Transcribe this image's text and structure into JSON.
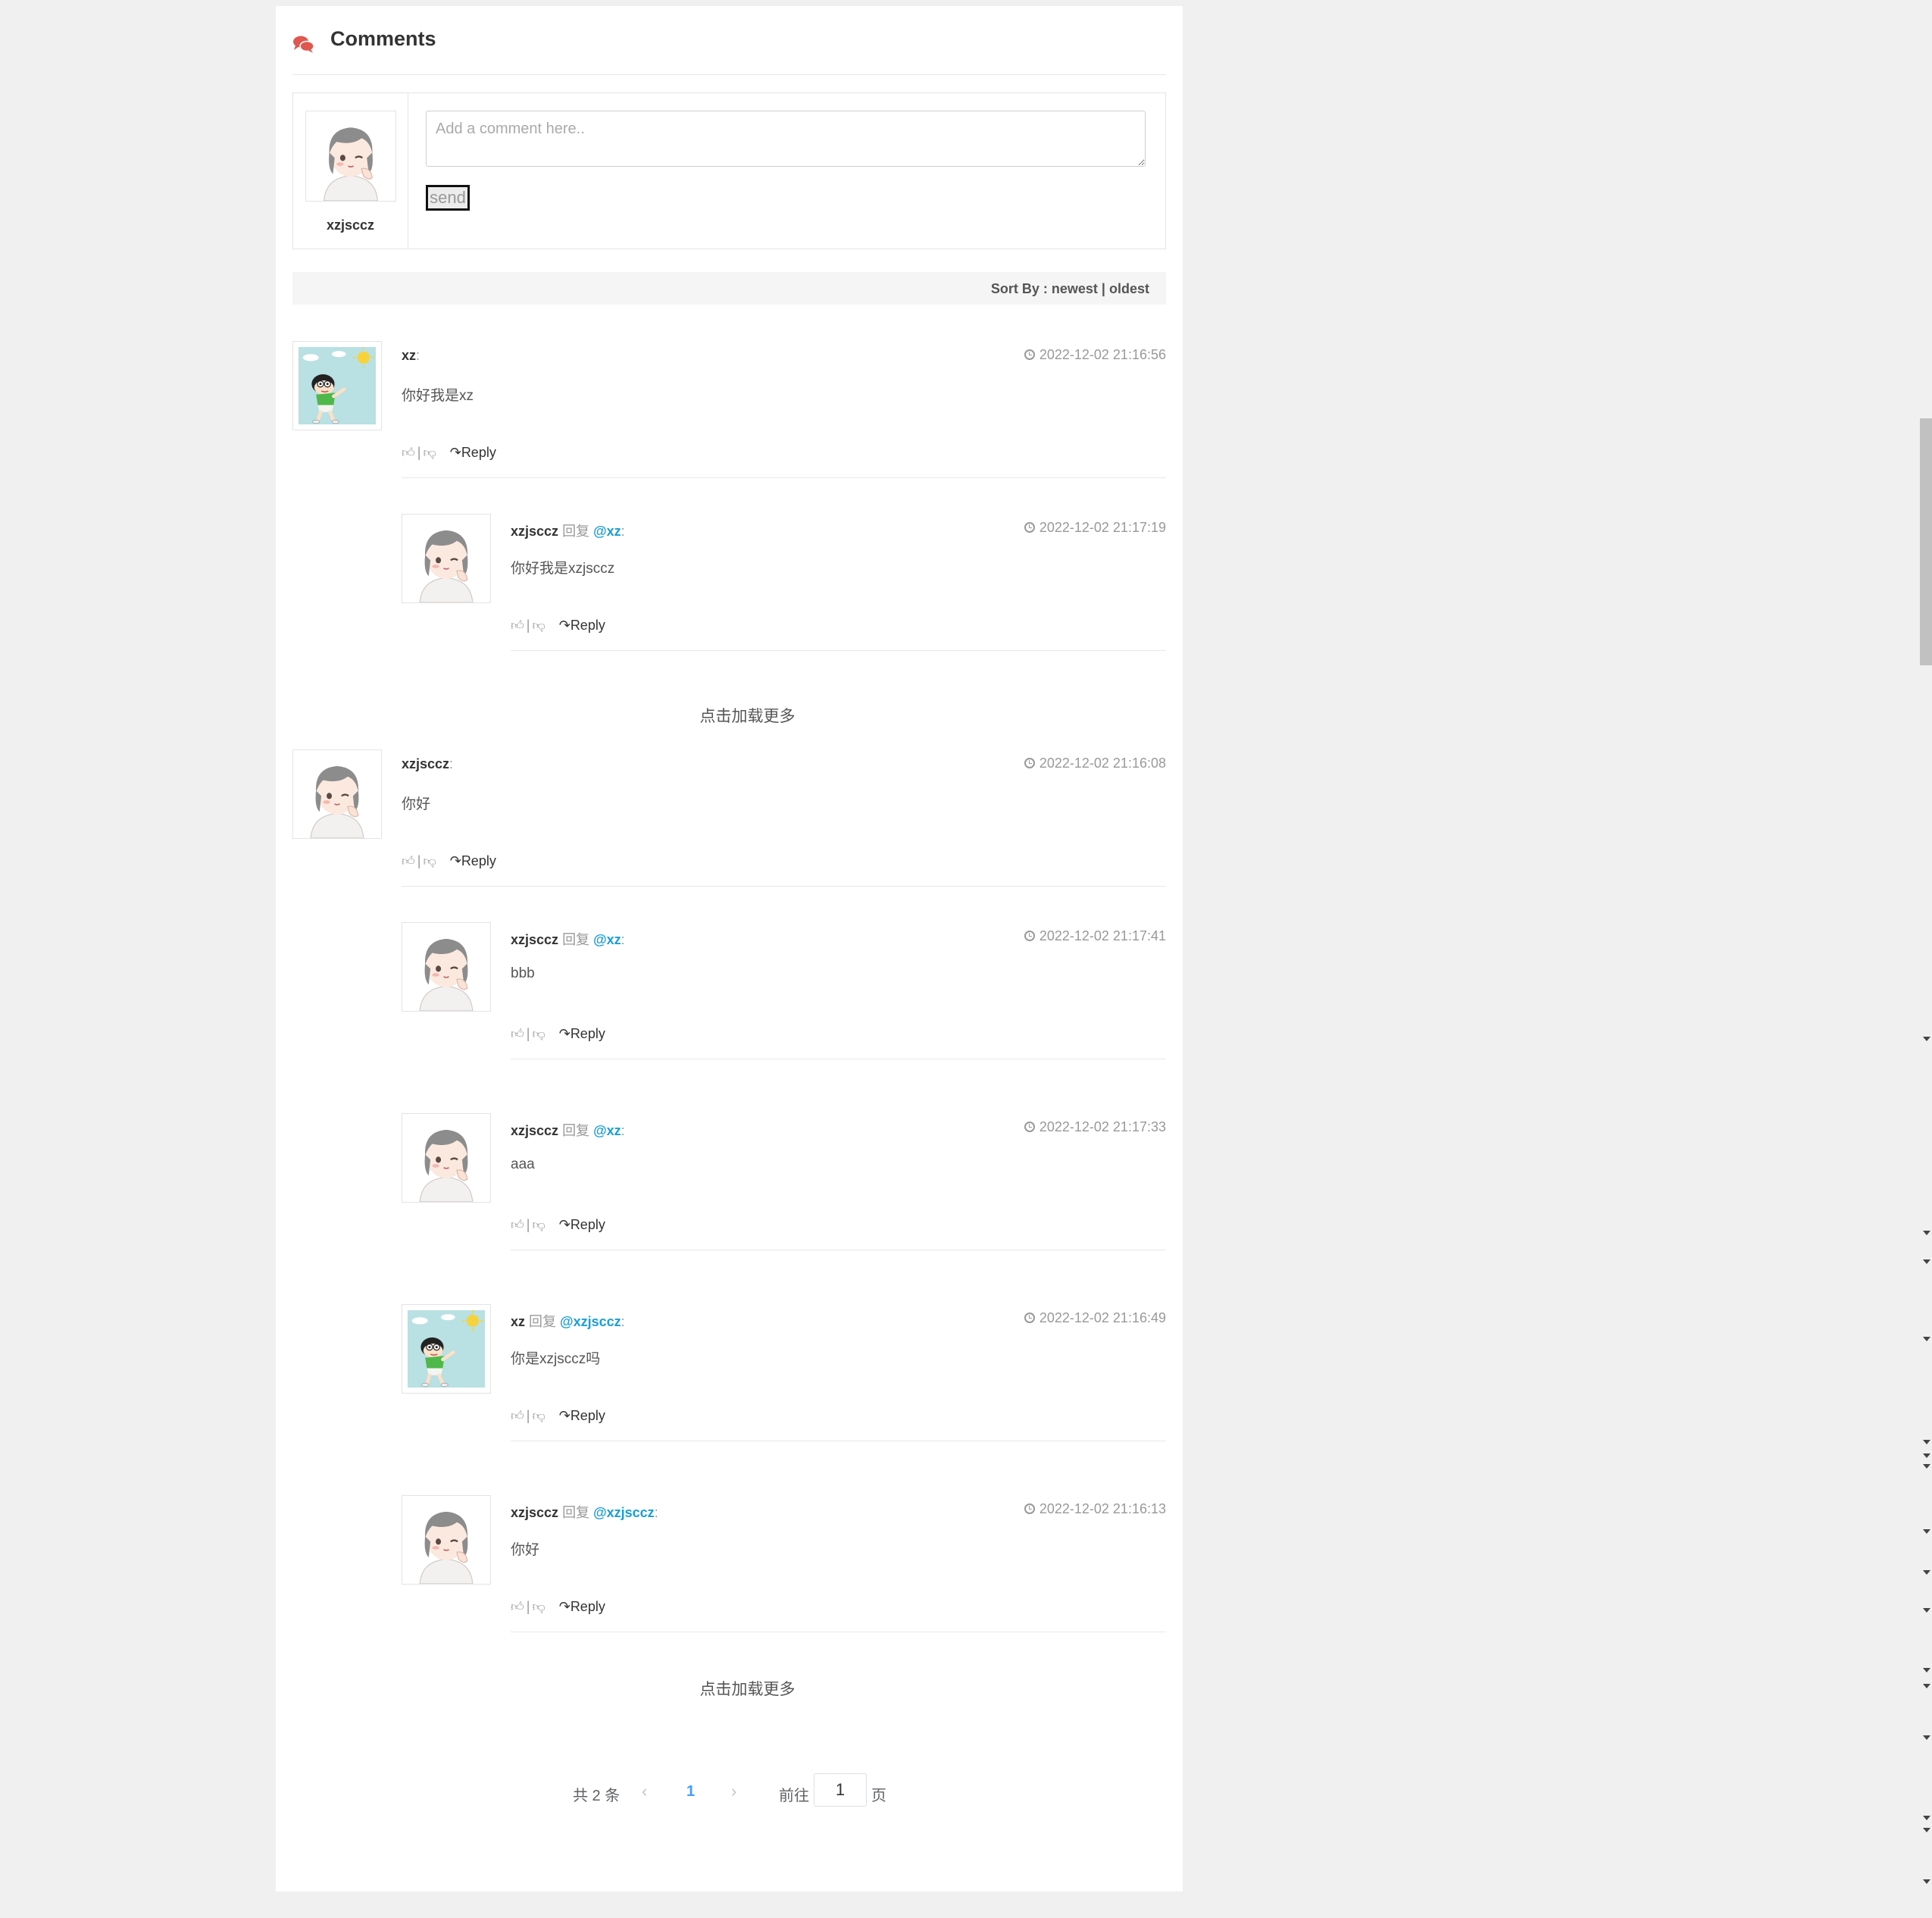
{
  "header": {
    "title": "Comments"
  },
  "compose": {
    "username": "xzjsccz",
    "placeholder": "Add a comment here..",
    "send_label": "send"
  },
  "sort": {
    "label": "Sort By :",
    "newest": "newest",
    "separator": "|",
    "oldest": "oldest"
  },
  "reply_word": "回复",
  "reply_label": "Reply",
  "load_more": "点击加载更多",
  "comments": [
    {
      "author": "xz",
      "target": "",
      "text": "你好我是xz",
      "time": "2022-12-02 21:16:56",
      "avatar": "cartoon-avatar"
    },
    {
      "author": "xzjsccz",
      "target": "@xz",
      "text": "你好我是xzjsccz",
      "time": "2022-12-02 21:17:19",
      "avatar": "girl-avatar"
    },
    {
      "author": "xzjsccz",
      "target": "",
      "text": "你好",
      "time": "2022-12-02 21:16:08",
      "avatar": "girl-avatar"
    },
    {
      "author": "xzjsccz",
      "target": "@xz",
      "text": "bbb",
      "time": "2022-12-02 21:17:41",
      "avatar": "girl-avatar"
    },
    {
      "author": "xzjsccz",
      "target": "@xz",
      "text": "aaa",
      "time": "2022-12-02 21:17:33",
      "avatar": "girl-avatar"
    },
    {
      "author": "xz",
      "target": "@xzjsccz",
      "text": "你是xzjsccz吗",
      "time": "2022-12-02 21:16:49",
      "avatar": "cartoon-avatar"
    },
    {
      "author": "xzjsccz",
      "target": "@xzjsccz",
      "text": "你好",
      "time": "2022-12-02 21:16:13",
      "avatar": "girl-avatar"
    }
  ],
  "pagination": {
    "total": "共 2 条",
    "current_page": "1",
    "goto_label": "前往",
    "goto_value": "1",
    "page_unit": "页"
  }
}
